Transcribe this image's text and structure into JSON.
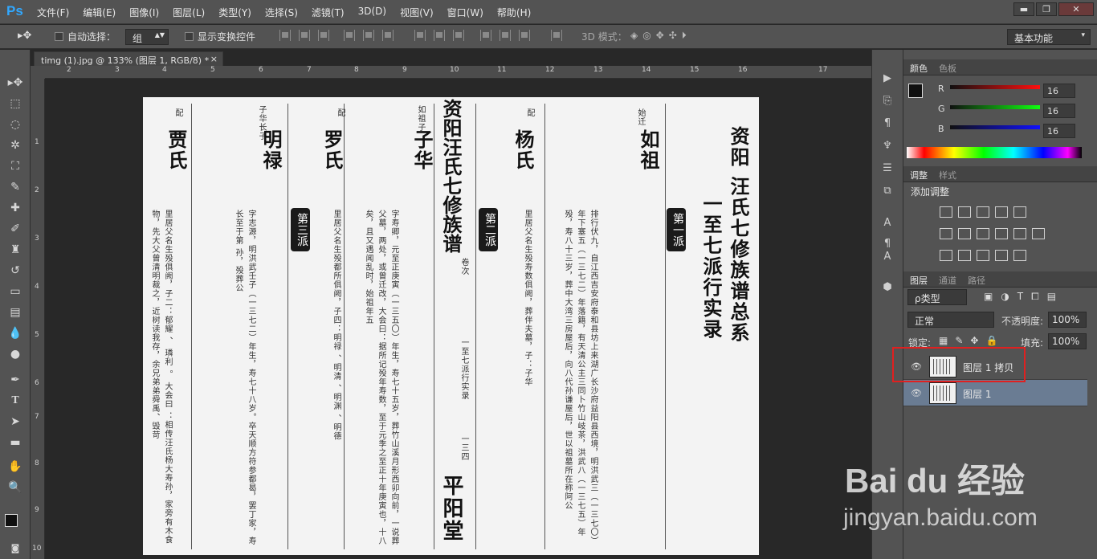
{
  "app": {
    "logo": "Ps"
  },
  "menu": [
    "文件(F)",
    "编辑(E)",
    "图像(I)",
    "图层(L)",
    "类型(Y)",
    "选择(S)",
    "滤镜(T)",
    "3D(D)",
    "视图(V)",
    "窗口(W)",
    "帮助(H)"
  ],
  "window_controls": {
    "minimize": "▬",
    "restore": "❐",
    "close": "✕"
  },
  "options": {
    "auto_select_label": "自动选择：",
    "auto_select_value": "组",
    "show_transform_label": "显示变换控件",
    "mode_3d_label": "3D 模式：",
    "workspace": "基本功能"
  },
  "document": {
    "tab_title": "timg (1).jpg @ 133% (图层 1, RGB/8) *",
    "tab_close": "×"
  },
  "ruler": {
    "h_ticks": [
      "2",
      "3",
      "4",
      "5",
      "6",
      "7",
      "8",
      "9",
      "10",
      "11",
      "12",
      "13",
      "14",
      "15",
      "16",
      "17"
    ],
    "v_ticks": [
      "1",
      "2",
      "3",
      "4",
      "5",
      "6",
      "7",
      "8",
      "9",
      "10"
    ]
  },
  "canvas_text": {
    "col1_head": "配",
    "col1_name": "贾氏",
    "col1_body": "里居父名生殁俱阙，子二：郁耀 、 璘利 。 大会曰 ：相传汪氏杨大寿孙，家旁有木食物，先大父曾清明裁之，近树读我存，余兄弟弟舜禹、毁苛",
    "col2_head": "子华长子",
    "col2_name": "明禄",
    "col2_body": "字志源，明洪武壬子（一三七二）年生，寿七十八岁。卒天顺方符参都曷，罢丁家，寿长至于第 孙，殁葬公",
    "col3_head": "配",
    "col3_name": "罗氏",
    "col3_body": "里居父名生殁都所俱阙，子四：明禄 、明清 、明渊 、明德",
    "badge3": "第三派",
    "col4_head": "如祖子",
    "col4_name": "子华",
    "col4_body": "字寿卿，元至正庚寅（一三五〇）年生，寿七十五岁，葬竹山溪月形西卯向前，一说葬父墓，两处，或曾迁改，大会曰：据所记殁年寿数，至于元季之至正十年庚寅也，十八矣，且又遇闻乱时，始祖年五",
    "spine_top": "资阳汪氏七修族谱",
    "spine_mid": "卷次",
    "spine_sub": "一至七派行实录",
    "spine_page": "一三四",
    "spine_bottom": "平阳堂",
    "col5_head": "配",
    "col5_name": "杨氏",
    "col5_body": "里居父名生殁寿数俱阙，葬伴夫墓，子：子华",
    "badge2": "第二派",
    "col6_head": "始迁",
    "col6_name": "如祖",
    "col6_body": "排行伏九，自江西吉安府泰和县坊上来湖广长沙府益阳县西境，明洪武三（一三七〇）年下塞五（一三七二）年落籍，有天清公主三同卜竹山岐茶，洪武八（一三七五）年殁，寿八十三岁，葬中大湾三房屋后，向八代孙谦屋后，世以祖墓所在称阿公",
    "badge1": "第一派",
    "title_right": "资阳 汪氏七修族谱总系",
    "title_sub": "一至七派行实录"
  },
  "right_dock_icons": [
    "play-icon",
    "history-icon",
    "paragraph-icon",
    "brush-settings-icon",
    "character-icon",
    "paragraph-style-icon",
    "clone-icon",
    "3d-icon"
  ],
  "color_panel": {
    "tabs": [
      "颜色",
      "色板"
    ],
    "channels": [
      {
        "label": "R",
        "value": "16"
      },
      {
        "label": "G",
        "value": "16"
      },
      {
        "label": "B",
        "value": "16"
      }
    ],
    "fg_color": "#101010",
    "bg_color": "#ff3c0a"
  },
  "adjust_panel": {
    "tabs": [
      "调整",
      "样式"
    ],
    "title": "添加调整"
  },
  "layers_panel": {
    "tabs": [
      "图层",
      "通道",
      "路径"
    ],
    "filter_label": "ρ类型",
    "blend_mode": "正常",
    "opacity_label": "不透明度:",
    "opacity_value": "100%",
    "lock_label": "锁定:",
    "fill_label": "填充:",
    "fill_value": "100%",
    "layers": [
      {
        "name": "图层 1 拷贝",
        "eye": "👁"
      },
      {
        "name": "图层 1",
        "eye": "👁"
      }
    ],
    "highlight_color": "#e02020"
  },
  "watermark": {
    "brand": "Bai du 经验",
    "url": "jingyan.baidu.com"
  }
}
